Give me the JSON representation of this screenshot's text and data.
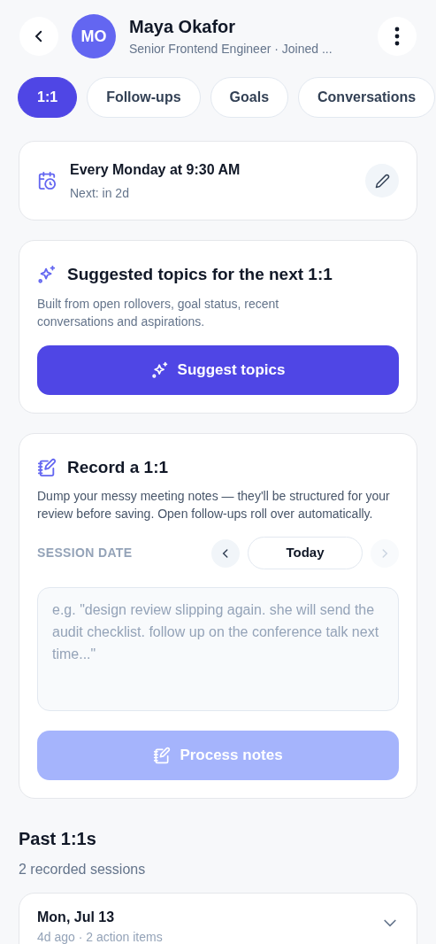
{
  "header": {
    "avatar_initials": "MO",
    "name": "Maya Okafor",
    "subtitle": "Senior Frontend Engineer · Joined ..."
  },
  "tabs": [
    {
      "label": "1:1",
      "selected": true
    },
    {
      "label": "Follow-ups",
      "selected": false
    },
    {
      "label": "Goals",
      "selected": false
    },
    {
      "label": "Conversations",
      "selected": false
    }
  ],
  "schedule": {
    "title": "Every Monday at 9:30 AM",
    "next": "Next: in 2d"
  },
  "suggest": {
    "title": "Suggested topics for the next 1:1",
    "description": "Built from open rollovers, goal status, recent conversations and aspirations.",
    "button": "Suggest topics"
  },
  "record": {
    "title": "Record a 1:1",
    "description": "Dump your messy meeting notes — they'll be structured for your review before saving. Open follow-ups roll over automatically.",
    "date_label": "SESSION DATE",
    "date_value": "Today",
    "next_disabled": true,
    "placeholder": "e.g. \"design review slipping again. she will send the audit checklist. follow up on the conference talk next time...\"",
    "button": "Process notes",
    "button_disabled": true
  },
  "past": {
    "title": "Past 1:1s",
    "count": "2 recorded sessions",
    "sessions": [
      {
        "date": "Mon, Jul 13",
        "meta": "4d ago · 2 action items",
        "expanded": false
      }
    ]
  }
}
